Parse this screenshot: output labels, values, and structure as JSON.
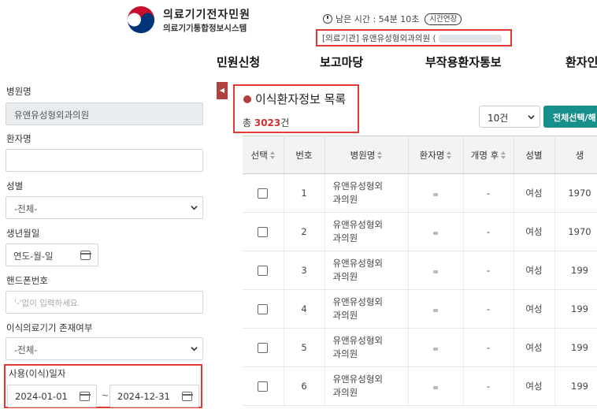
{
  "header": {
    "brand_title": "의료기기전자민원",
    "brand_subtitle": "의료기기통합정보시스템",
    "session_label": "남은 시간 : 54분 10초",
    "extend_button": "시간연장",
    "org_text": "[의료기관] 유앤유성형외과의원 ("
  },
  "nav": {
    "items": [
      "민원신청",
      "보고마당",
      "부작용환자통보",
      "환자인"
    ]
  },
  "sidebar": {
    "hospital_label": "병원명",
    "hospital_value": "유앤유성형외과의원",
    "patient_label": "환자명",
    "patient_value": "",
    "gender_label": "성별",
    "gender_value": "-전체-",
    "birth_label": "생년월일",
    "birth_value": "연도-월-일",
    "phone_label": "핸드폰번호",
    "phone_placeholder": "'-'없이 입력하세요.",
    "device_label": "이식의료기기 존재여부",
    "device_value": "-전체-",
    "range_label": "사용(이식)일자",
    "range_start": "2024-01-01",
    "range_end": "2024-12-31",
    "range_sep": "~"
  },
  "main": {
    "toggle": "◀",
    "list_title": "이식환자정보 목록",
    "total_prefix": "총 ",
    "total_count": "3023",
    "total_suffix": "건",
    "page_size": "10건",
    "select_all": "전체선택/해"
  },
  "table": {
    "columns": [
      "선택",
      "번호",
      "병원명",
      "환자명",
      "개명 후",
      "성별",
      "생"
    ],
    "rows": [
      {
        "no": "1",
        "hospital_a": "유앤유성형외",
        "hospital_b": "과의원",
        "rename": "-",
        "gender": "여성",
        "birth": "1970"
      },
      {
        "no": "2",
        "hospital_a": "유앤유성형외",
        "hospital_b": "과의원",
        "rename": "-",
        "gender": "여성",
        "birth": "1970"
      },
      {
        "no": "3",
        "hospital_a": "유앤유성형외",
        "hospital_b": "과의원",
        "rename": "-",
        "gender": "여성",
        "birth": "199"
      },
      {
        "no": "4",
        "hospital_a": "유앤유성형외",
        "hospital_b": "과의원",
        "rename": "-",
        "gender": "여성",
        "birth": "199"
      },
      {
        "no": "5",
        "hospital_a": "유앤유성형외",
        "hospital_b": "과의원",
        "rename": "-",
        "gender": "여성",
        "birth": "199"
      },
      {
        "no": "6",
        "hospital_a": "유앤유성형외",
        "hospital_b": "과의원",
        "rename": "-",
        "gender": "여성",
        "birth": "199"
      }
    ]
  },
  "colors": {
    "accent": "#b0413e",
    "highlight_border": "#e53935",
    "button_teal": "#17908c"
  }
}
